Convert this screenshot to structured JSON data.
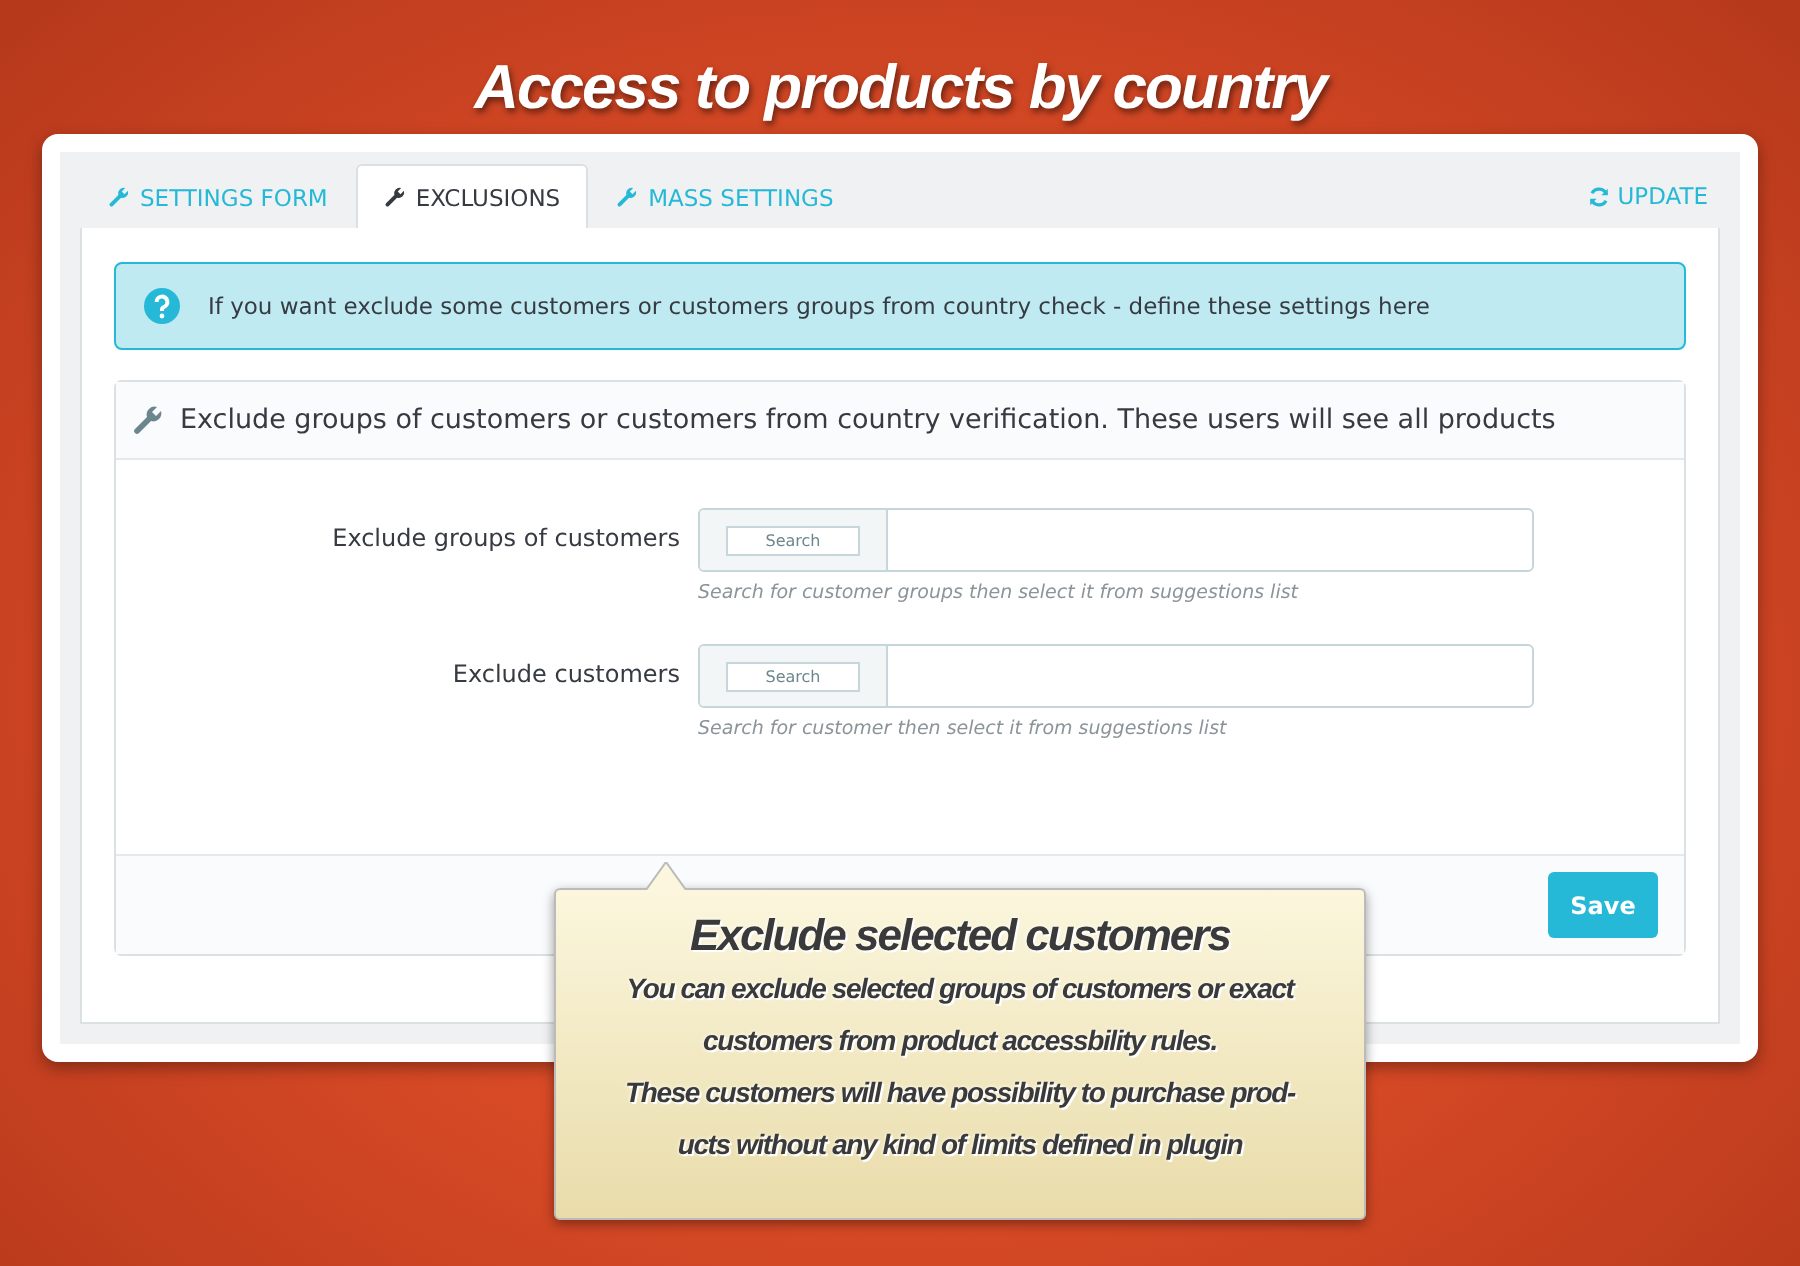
{
  "page_title": "Access to products by country",
  "tabs": [
    {
      "label": "SETTINGS FORM",
      "selected": false
    },
    {
      "label": "EXCLUSIONS",
      "selected": true
    },
    {
      "label": "MASS SETTINGS",
      "selected": false
    }
  ],
  "update_link": "UPDATE",
  "alert": "If you want exclude some customers or customers groups from country check - define these settings here",
  "panel": {
    "title": "Exclude groups of customers or customers from country verification. These users will see all products",
    "fields": [
      {
        "label": "Exclude groups of customers",
        "search_button": "Search",
        "help": "Search for customer groups then select it from suggestions list"
      },
      {
        "label": "Exclude customers",
        "search_button": "Search",
        "help": "Search for customer then select it from suggestions list"
      }
    ],
    "save_button": "Save"
  },
  "callout": {
    "title": "Exclude selected customers",
    "lines": [
      "You can exclude selected groups of customers or exact",
      "customers from product accessbility rules.",
      "These customers will have possibility to purchase prod-",
      "ucts without any kind of limits defined in plugin"
    ]
  }
}
